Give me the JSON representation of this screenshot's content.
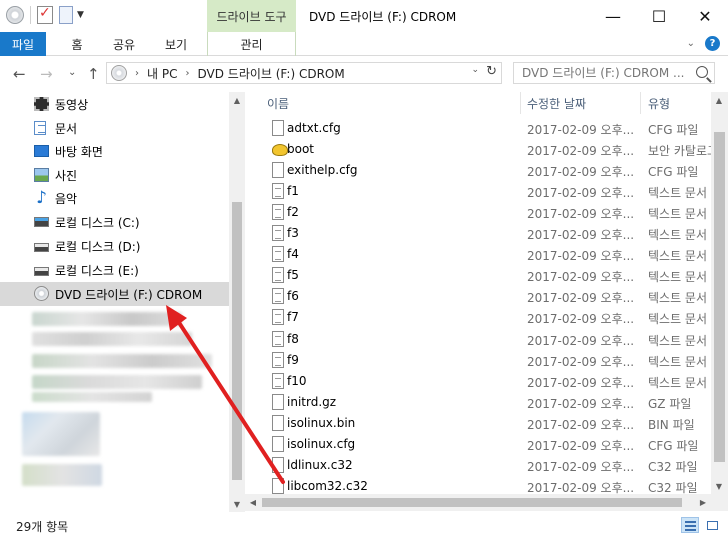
{
  "titlebar": {
    "contextual_tab": "드라이브 도구",
    "title": "DVD 드라이브 (F:) CDROM",
    "minimize": "—",
    "maximize": "☐",
    "close": "✕"
  },
  "ribbon": {
    "tabs": [
      "파일",
      "홈",
      "공유",
      "보기"
    ],
    "contextual_tab": "관리",
    "collapse": "⌄"
  },
  "nav": {
    "back": "←",
    "forward": "→",
    "recent": "⌄",
    "up": "↑"
  },
  "address": {
    "crumbs": [
      "내 PC",
      "DVD 드라이브 (F:) CDROM"
    ],
    "separator": "›",
    "dropdown": "⌄",
    "refresh": "↻"
  },
  "search": {
    "placeholder": "DVD 드라이브 (F:) CDROM ..."
  },
  "sidebar": {
    "items": [
      {
        "label": "동영상",
        "icon": "video-icon"
      },
      {
        "label": "문서",
        "icon": "document-icon"
      },
      {
        "label": "바탕 화면",
        "icon": "desktop-icon"
      },
      {
        "label": "사진",
        "icon": "pictures-icon"
      },
      {
        "label": "음악",
        "icon": "music-icon"
      },
      {
        "label": "로컬 디스크 (C:)",
        "icon": "local-disk-c-icon"
      },
      {
        "label": "로컬 디스크 (D:)",
        "icon": "local-disk-icon"
      },
      {
        "label": "로컬 디스크 (E:)",
        "icon": "local-disk-icon"
      },
      {
        "label": "DVD 드라이브 (F:) CDROM",
        "icon": "dvd-drive-icon",
        "selected": true
      }
    ]
  },
  "columns": {
    "name": "이름",
    "date": "수정한 날짜",
    "type": "유형"
  },
  "files": [
    {
      "name": "adtxt.cfg",
      "date": "2017-02-09 오후...",
      "type": "CFG 파일",
      "icon": "file-icon"
    },
    {
      "name": "boot",
      "date": "2017-02-09 오후...",
      "type": "보안 카탈로그",
      "icon": "security-catalog-icon"
    },
    {
      "name": "exithelp.cfg",
      "date": "2017-02-09 오후...",
      "type": "CFG 파일",
      "icon": "file-icon"
    },
    {
      "name": "f1",
      "date": "2017-02-09 오후...",
      "type": "텍스트 문서",
      "icon": "text-file-icon"
    },
    {
      "name": "f2",
      "date": "2017-02-09 오후...",
      "type": "텍스트 문서",
      "icon": "text-file-icon"
    },
    {
      "name": "f3",
      "date": "2017-02-09 오후...",
      "type": "텍스트 문서",
      "icon": "text-file-icon"
    },
    {
      "name": "f4",
      "date": "2017-02-09 오후...",
      "type": "텍스트 문서",
      "icon": "text-file-icon"
    },
    {
      "name": "f5",
      "date": "2017-02-09 오후...",
      "type": "텍스트 문서",
      "icon": "text-file-icon"
    },
    {
      "name": "f6",
      "date": "2017-02-09 오후...",
      "type": "텍스트 문서",
      "icon": "text-file-icon"
    },
    {
      "name": "f7",
      "date": "2017-02-09 오후...",
      "type": "텍스트 문서",
      "icon": "text-file-icon"
    },
    {
      "name": "f8",
      "date": "2017-02-09 오후...",
      "type": "텍스트 문서",
      "icon": "text-file-icon"
    },
    {
      "name": "f9",
      "date": "2017-02-09 오후...",
      "type": "텍스트 문서",
      "icon": "text-file-icon"
    },
    {
      "name": "f10",
      "date": "2017-02-09 오후...",
      "type": "텍스트 문서",
      "icon": "text-file-icon"
    },
    {
      "name": "initrd.gz",
      "date": "2017-02-09 오후...",
      "type": "GZ 파일",
      "icon": "file-icon"
    },
    {
      "name": "isolinux.bin",
      "date": "2017-02-09 오후...",
      "type": "BIN 파일",
      "icon": "file-icon"
    },
    {
      "name": "isolinux.cfg",
      "date": "2017-02-09 오후...",
      "type": "CFG 파일",
      "icon": "file-icon"
    },
    {
      "name": "ldlinux.c32",
      "date": "2017-02-09 오후...",
      "type": "C32 파일",
      "icon": "file-icon"
    },
    {
      "name": "libcom32.c32",
      "date": "2017-02-09 오후...",
      "type": "C32 파일",
      "icon": "file-icon"
    }
  ],
  "status": {
    "item_count": "29개 항목"
  },
  "colors": {
    "file_tab": "#1979ca",
    "contextual_tab": "#d6eac7",
    "selection": "#d9d9d9",
    "annotation_arrow": "#e02020"
  }
}
